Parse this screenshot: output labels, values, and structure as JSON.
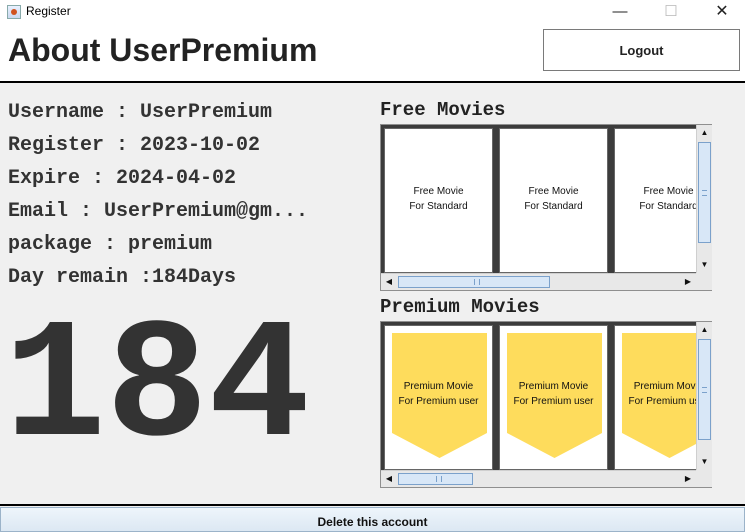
{
  "window": {
    "title": "Register",
    "minimize": "—",
    "maximize": "☐",
    "close": "✕"
  },
  "header": {
    "title": "About UserPremium",
    "logout_label": "Logout"
  },
  "info": {
    "username": "Username : UserPremium",
    "register": "Register : 2023-10-02",
    "expire": "Expire : 2024-04-02",
    "email": "Email : UserPremium@gm...",
    "package": "package : premium",
    "day_remain": "Day remain :184Days"
  },
  "days_remaining": "184",
  "free_movies": {
    "title": "Free Movies",
    "cards": [
      {
        "line1": "Free Movie",
        "line2": "For Standard"
      },
      {
        "line1": "Free Movie",
        "line2": "For Standard"
      },
      {
        "line1": "Free Movie",
        "line2": "For Standard"
      }
    ]
  },
  "premium_movies": {
    "title": "Premium Movies",
    "banner_color": "#fedc5c",
    "cards": [
      {
        "line1": "Premium Movie",
        "line2": "For Premium user"
      },
      {
        "line1": "Premium Movie",
        "line2": "For Premium user"
      },
      {
        "line1": "Premium Movie",
        "line2": "For Premium user"
      }
    ]
  },
  "footer": {
    "delete_label": "Delete this account"
  },
  "icons": {
    "scroll_up": "▲",
    "scroll_down": "▼",
    "scroll_left": "◀",
    "scroll_right": "▶"
  }
}
